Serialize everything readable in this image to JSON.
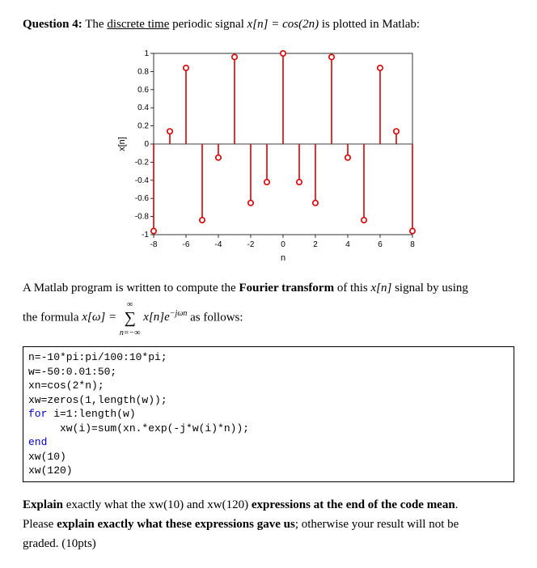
{
  "question": {
    "label": "Question 4:",
    "text_part1": "The ",
    "underline": "discrete time",
    "text_part2": " periodic signal  ",
    "signal_eq": "x[n] = cos(2n)",
    "text_part3": "  is plotted in Matlab:"
  },
  "chart_data": {
    "type": "stem",
    "title": "",
    "xlabel": "n",
    "ylabel": "x[n]",
    "xlim": [
      -8,
      8
    ],
    "ylim": [
      -1,
      1
    ],
    "xticks": [
      -8,
      -6,
      -4,
      -2,
      0,
      2,
      4,
      6,
      8
    ],
    "yticks": [
      -1,
      -0.8,
      -0.6,
      -0.4,
      -0.2,
      0,
      0.2,
      0.4,
      0.6,
      0.8,
      1
    ],
    "n": [
      -8,
      -7,
      -6,
      -5,
      -4,
      -3,
      -2,
      -1,
      0,
      1,
      2,
      3,
      4,
      5,
      6,
      7,
      8
    ],
    "values": [
      -0.96,
      0.14,
      0.84,
      -0.84,
      -0.15,
      0.96,
      -0.65,
      -0.42,
      1.0,
      -0.42,
      -0.65,
      0.96,
      -0.15,
      -0.84,
      0.84,
      0.14,
      -0.96
    ],
    "color": "#d60000"
  },
  "intro": {
    "line1_a": "A Matlab program is written to compute the ",
    "line1_bold": "Fourier transform",
    "line1_b": " of this ",
    "line1_sig": "x[n]",
    "line1_c": " signal by using",
    "line2_a": "the formula  ",
    "formula": "x[ω] = Σ x[n]e",
    "formula_exp": "−jωn",
    "formula_sum_low": "n=−∞",
    "formula_sum_high": "∞",
    "line2_b": " as follows:"
  },
  "code": {
    "l1": "n=-10*pi:pi/100:10*pi;",
    "l2": "w=-50:0.01:50;",
    "l3": "xn=cos(2*n);",
    "l4": "xw=zeros(1,length(w));",
    "l5a": "for",
    "l5b": " i=1:length(w)",
    "l6": "     xw(i)=sum(xn.*exp(-j*w(i)*n));",
    "l7": "end",
    "l8": "xw(10)",
    "l9": "xw(120)"
  },
  "explain": {
    "p1_a": "Explain",
    "p1_b": " exactly what the xw(10) and xw(120) ",
    "p1_c": "expressions at the end of the code mean",
    "p1_d": ".",
    "p2_a": "Please ",
    "p2_b": "explain exactly what these expressions gave us",
    "p2_c": "; otherwise your result will not be",
    "p3": "graded. (10pts)"
  }
}
